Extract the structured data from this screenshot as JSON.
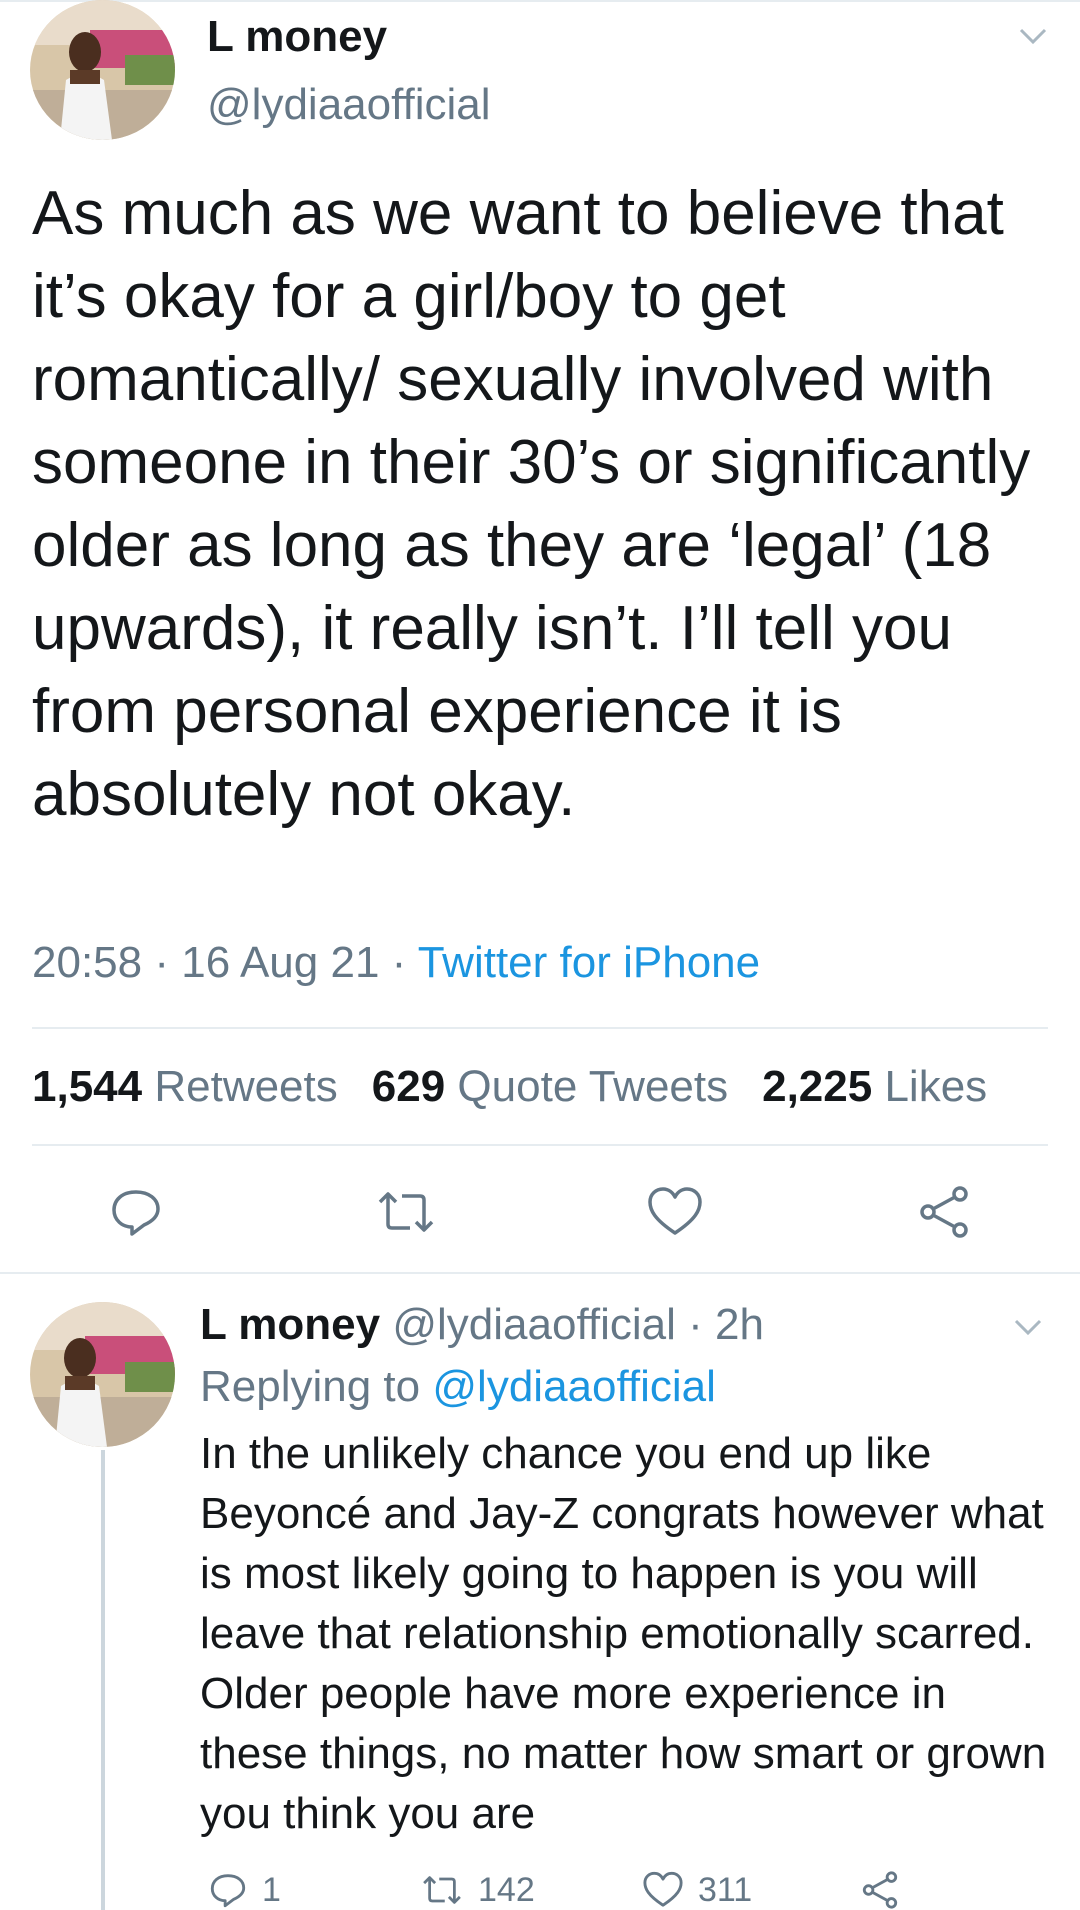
{
  "tweet": {
    "author_name": "L money",
    "author_handle": "@lydiaaofficial",
    "text": "As much as we want to believe that it’s okay for a girl/boy to get romantically/ sexually involved with someone in their 30’s or significantly older as long as they are ‘legal’ (18 upwards), it really isn’t. I’ll tell you from personal experience it is absolutely not okay.",
    "time": "20:58",
    "separator": " · ",
    "date": "16 Aug 21",
    "source": "Twitter for iPhone",
    "stats": {
      "retweets_count": "1,544",
      "retweets_label": "Retweets",
      "quotes_count": "629",
      "quotes_label": "Quote Tweets",
      "likes_count": "2,225",
      "likes_label": "Likes"
    },
    "actions": [
      "reply-icon",
      "retweet-icon",
      "like-icon",
      "share-icon"
    ]
  },
  "reply": {
    "author_name": "L money",
    "author_handle": "@lydiaaofficial",
    "time_ago": "2h",
    "separator": " · ",
    "replying_label": "Replying to",
    "replying_to": "@lydiaaofficial",
    "text": "In the unlikely chance you end up like Beyoncé and Jay-Z congrats however what is most likely going to happen is you will leave that relationship emotionally scarred. Older people have more experience in these things, no matter how smart or grown you think you are",
    "reply_count": "1",
    "retweet_count": "142",
    "like_count": "311"
  },
  "colors": {
    "text": "#14171a",
    "secondary": "#657786",
    "link": "#1b95e0",
    "divider": "#e6ecf0"
  }
}
